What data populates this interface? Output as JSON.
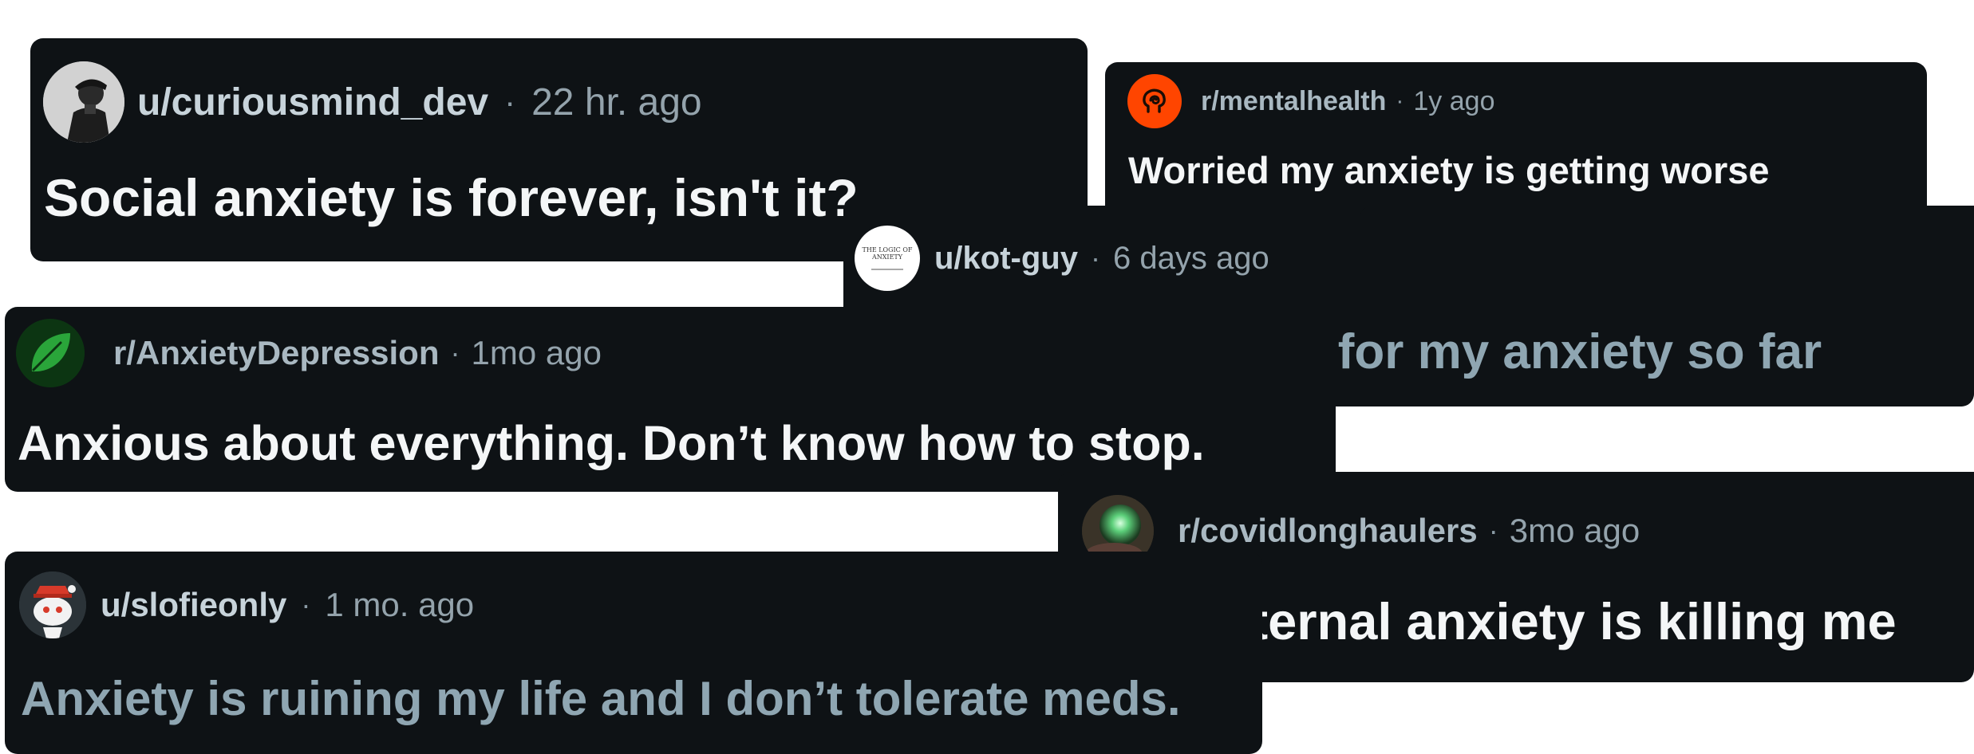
{
  "cards": [
    {
      "author": "u/curiousmind_dev",
      "time": "22 hr. ago",
      "title": "Social anxiety is forever, isn't it?",
      "avatar_icon": "person-photo-icon"
    },
    {
      "author": "r/mentalhealth",
      "time": "1y ago",
      "title": "Worried my anxiety is getting worse",
      "avatar_icon": "brain-swirl-icon",
      "accent": "#ff4500"
    },
    {
      "author": "u/kot-guy",
      "time": "6 days ago",
      "title": "Nothing has worked for my anxiety so far",
      "avatar_text_1": "THE LOGIC OF",
      "avatar_text_2": "ANXIETY",
      "avatar_icon": "book-cover-icon"
    },
    {
      "author": "r/AnxietyDepression",
      "time": "1mo ago",
      "title": "Anxious about everything. Don’t know how to stop.",
      "avatar_icon": "leaf-icon",
      "accent": "#1f8a2e"
    },
    {
      "author": "r/covidlonghaulers",
      "time": "3mo ago",
      "title": "This internal anxiety is killing me",
      "avatar_icon": "glowing-orb-icon"
    },
    {
      "author": "u/slofieonly",
      "time": "1 mo. ago",
      "title": "Anxiety is ruining my life and I don’t tolerate meds.",
      "avatar_icon": "snoo-avatar-icon"
    }
  ],
  "separator": "·"
}
